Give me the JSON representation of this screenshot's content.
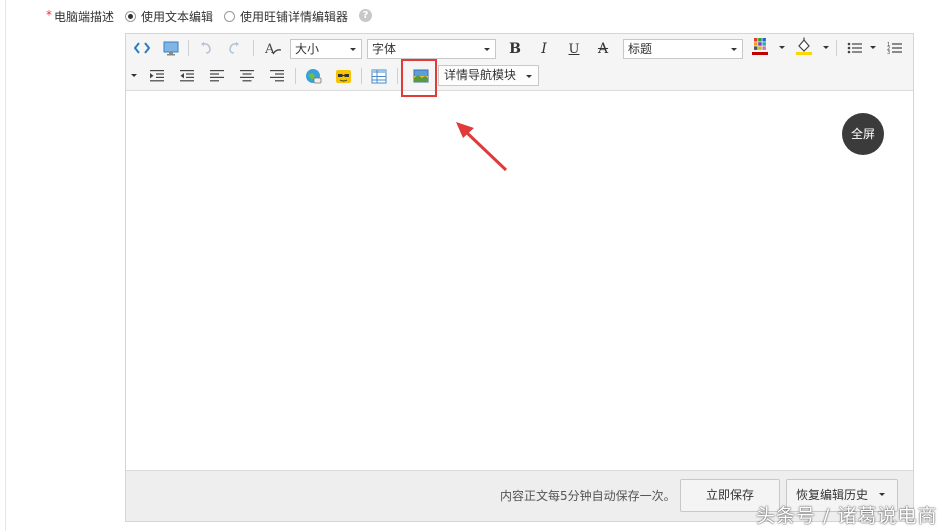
{
  "field": {
    "required_mark": "*",
    "label": "电脑端描述",
    "options": [
      {
        "label": "使用文本编辑",
        "selected": true
      },
      {
        "label": "使用旺铺详情编辑器",
        "selected": false
      }
    ],
    "help": "?"
  },
  "toolbar": {
    "size_combo": "大小",
    "font_combo": "字体",
    "bold": "B",
    "italic": "I",
    "underline": "U",
    "strike": "A",
    "heading_combo": "标题",
    "nav_module": "详情导航模块"
  },
  "colors": {
    "annotation": "#e03a3a",
    "font_color_bar": "#c00000",
    "highlight_bar": "#ffd700"
  },
  "editor": {
    "fullscreen_label": "全屏"
  },
  "footer": {
    "autosave_text": "内容正文每5分钟自动保存一次。",
    "save_now": "立即保存",
    "restore_history": "恢复编辑历史"
  },
  "watermark": "头条号 / 诸葛说电商"
}
